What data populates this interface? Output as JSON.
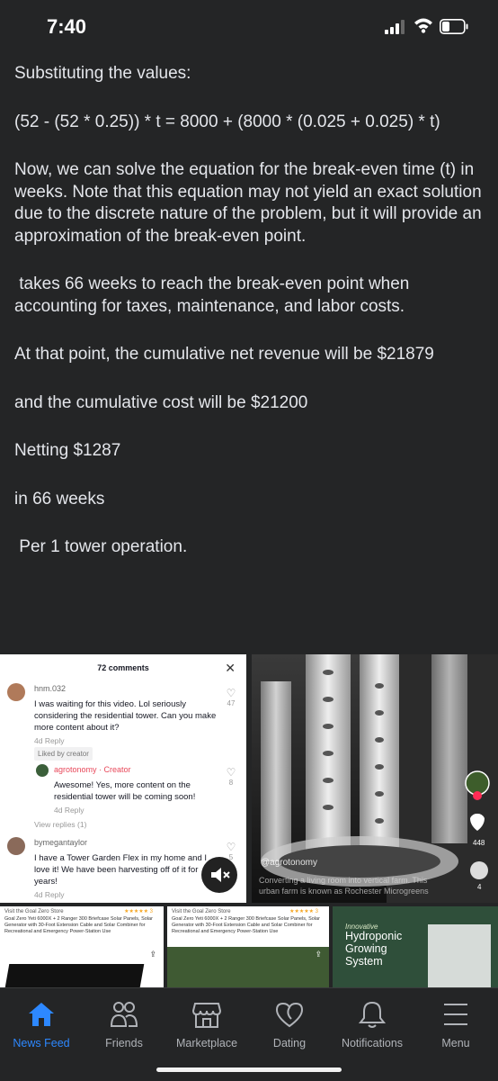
{
  "status": {
    "time": "7:40"
  },
  "post": {
    "paragraphs": [
      "Substituting the values:",
      "(52 - (52 * 0.25)) * t = 8000 + (8000 * (0.025 + 0.025) * t)",
      "Now, we can solve the equation for the break-even time (t) in weeks. Note that this equation may not yield an exact solution due to the discrete nature of the problem, but it will provide an approximation of the break-even point.",
      " takes 66 weeks to reach the break-even point when accounting for taxes, maintenance, and labor costs.",
      "At that point, the cumulative net revenue will be $21879",
      "and the cumulative cost will be $21200",
      "Netting $1287",
      "in 66 weeks",
      " Per 1 tower operation."
    ]
  },
  "comments_panel": {
    "count": "72 comments",
    "comments": [
      {
        "user": "hnm.032",
        "text": "I was waiting for this video. Lol seriously considering the residential tower. Can you make more content about it?",
        "meta": "4d  Reply",
        "liked": "Liked by creator",
        "likes": "47"
      },
      {
        "user": "agrotonomy · Creator",
        "text": "Awesome! Yes, more content on the residential tower will be coming soon!",
        "meta": "4d  Reply",
        "likes": "8",
        "view_replies": "View replies (1)"
      },
      {
        "user": "bymegantaylor",
        "text": "I have a Tower Garden Flex in my home and I love it! We have been harvesting off of it for years!",
        "meta": "4d  Reply",
        "likes": "5"
      }
    ]
  },
  "video": {
    "handle": "@agrotonomy",
    "caption": "Converting a living room into vertical farm. This urban farm is known as Rochester Microgreens",
    "side_counts": [
      "448",
      "4"
    ]
  },
  "ads": [
    {
      "store": "Visit the Goal Zero Store",
      "stars": "★★★★★ 3",
      "desc": "Goal Zero Yeti 6000X + 2 Ranger 300 Briefcase Solar Panels, Solar Generator with 30-Foot Extension Cable and Solar Combiner for Recreational and Emergency Power-Station Use"
    },
    {
      "store": "Visit the Goal Zero Store",
      "stars": "★★★★★ 3",
      "desc": "Goal Zero Yeti 6000X + 2 Ranger 300 Briefcase Solar Panels, Solar Generator with 30-Foot Extension Cable and Solar Combiner for Recreational and Emergency Power-Station Use"
    },
    {
      "italic": "Innovative",
      "title": "Hydroponic Growing System"
    }
  ],
  "tabs": [
    {
      "label": "News Feed",
      "icon": "home-icon",
      "active": true
    },
    {
      "label": "Friends",
      "icon": "friends-icon"
    },
    {
      "label": "Marketplace",
      "icon": "marketplace-icon"
    },
    {
      "label": "Dating",
      "icon": "dating-icon"
    },
    {
      "label": "Notifications",
      "icon": "bell-icon"
    },
    {
      "label": "Menu",
      "icon": "menu-icon"
    }
  ],
  "colors": {
    "accent": "#2d88ff",
    "background": "#242526",
    "text": "#e4e6eb"
  }
}
